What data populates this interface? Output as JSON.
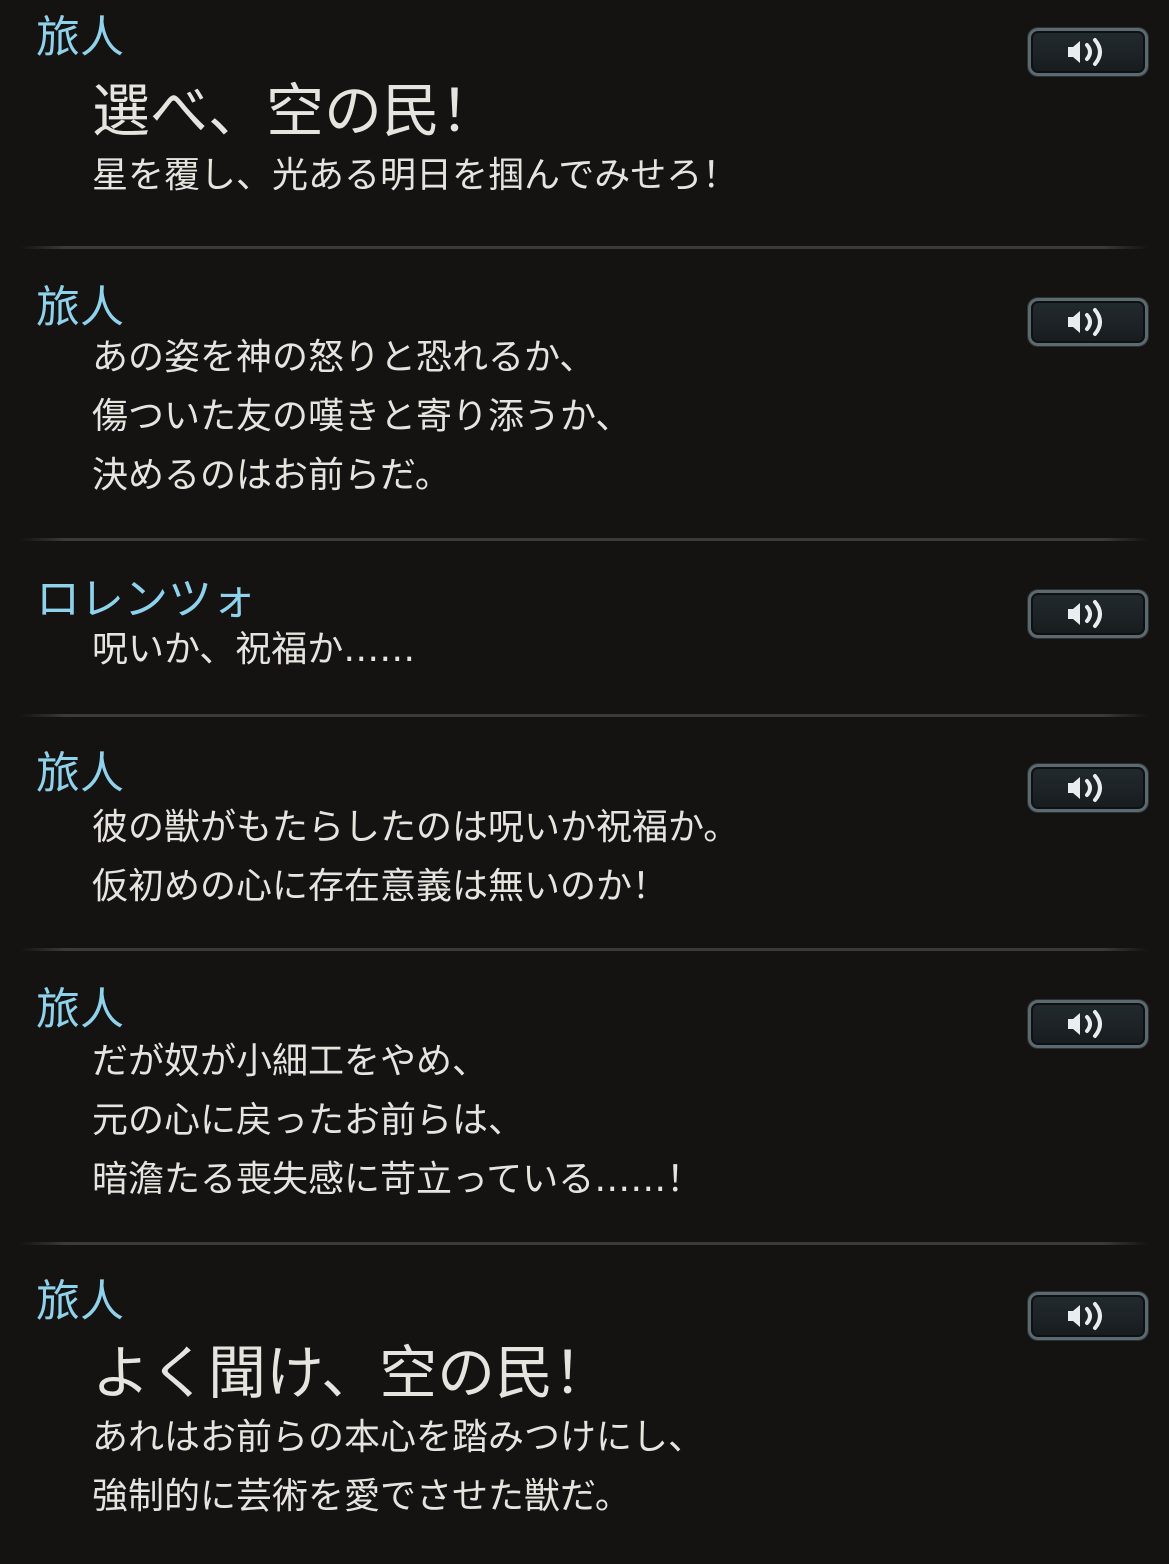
{
  "entries": [
    {
      "speaker": "旅人",
      "lines": [
        {
          "text": "選べ、空の民！",
          "big": true
        },
        {
          "text": "星を覆し、光ある明日を掴んでみせろ！",
          "big": false
        }
      ],
      "voice_icon": "speaker-icon"
    },
    {
      "speaker": "旅人",
      "lines": [
        {
          "text": "あの姿を神の怒りと恐れるか、",
          "big": false
        },
        {
          "text": "傷ついた友の嘆きと寄り添うか、",
          "big": false
        },
        {
          "text": "決めるのはお前らだ。",
          "big": false
        }
      ],
      "voice_icon": "speaker-icon"
    },
    {
      "speaker": "ロレンツォ",
      "lines": [
        {
          "text": "呪いか、祝福か……",
          "big": false
        }
      ],
      "voice_icon": "speaker-icon"
    },
    {
      "speaker": "旅人",
      "lines": [
        {
          "text": "彼の獣がもたらしたのは呪いか祝福か。",
          "big": false
        },
        {
          "text": "仮初めの心に存在意義は無いのか！",
          "big": false
        }
      ],
      "voice_icon": "speaker-icon"
    },
    {
      "speaker": "旅人",
      "lines": [
        {
          "text": "だが奴が小細工をやめ、",
          "big": false
        },
        {
          "text": "元の心に戻ったお前らは、",
          "big": false
        },
        {
          "text": "暗澹たる喪失感に苛立っている……！",
          "big": false
        }
      ],
      "voice_icon": "speaker-icon"
    },
    {
      "speaker": "旅人",
      "lines": [
        {
          "text": "よく聞け、空の民！",
          "big": true
        },
        {
          "text": "あれはお前らの本心を踏みつけにし、",
          "big": false
        },
        {
          "text": "強制的に芸術を愛でさせた獣だ。",
          "big": false
        }
      ],
      "voice_icon": "speaker-icon"
    }
  ]
}
